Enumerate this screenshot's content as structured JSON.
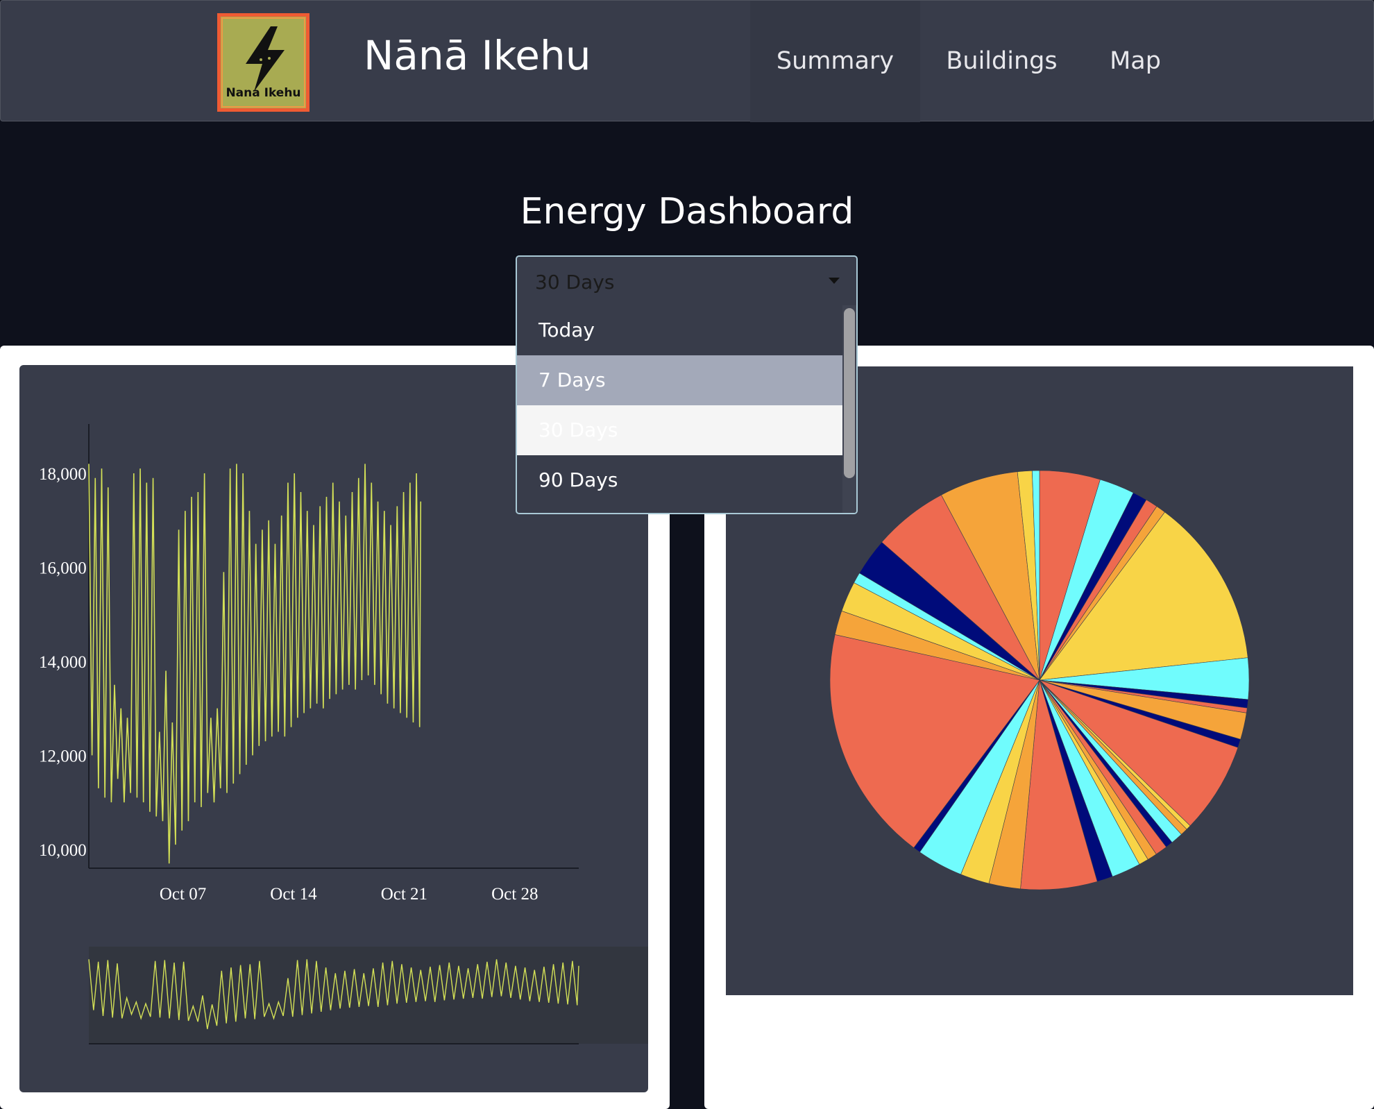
{
  "navbar": {
    "logo_text": "Nana Ikehu",
    "brand": "Nānā Ikehu",
    "items": [
      {
        "label": "Summary"
      },
      {
        "label": "Buildings"
      },
      {
        "label": "Map"
      }
    ]
  },
  "page": {
    "title": "Energy Dashboard"
  },
  "range_select": {
    "selected": "30 Days",
    "options": [
      "Today",
      "7 Days",
      "30 Days",
      "90 Days"
    ],
    "highlighted": "7 Days"
  },
  "colors": {
    "line": "#d4e157",
    "pie": [
      "#ee6a50",
      "#f5a43a",
      "#f8d447",
      "#70fcfd",
      "#000b7a"
    ]
  },
  "chart_data": [
    {
      "type": "line",
      "title": "",
      "xlabel": "",
      "ylabel": "",
      "x_ticks": [
        "Oct 07",
        "Oct 14",
        "Oct 21",
        "Oct 28"
      ],
      "y_ticks": [
        "10,000",
        "12,000",
        "14,000",
        "16,000",
        "18,000"
      ],
      "ylim": [
        9600,
        18900
      ],
      "x_range_days": [
        2,
        33
      ],
      "series": [
        {
          "x": [
            2.0,
            2.3,
            2.6,
            2.9,
            3.2,
            3.5,
            3.8,
            4.1,
            4.4,
            4.7,
            5.0,
            5.3,
            5.6,
            5.9,
            6.2,
            6.5,
            6.8,
            7.1,
            7.4,
            7.7,
            8.0,
            8.3,
            8.6,
            8.9,
            9.2,
            9.5,
            9.8,
            10.1,
            10.4,
            10.7,
            11.0,
            11.3,
            11.6,
            11.9,
            12.2,
            12.5,
            12.8,
            13.1,
            13.4,
            13.7,
            14.0,
            14.3,
            14.6,
            14.9,
            15.2,
            15.5,
            15.8,
            16.1,
            16.4,
            16.7,
            17.0,
            17.3,
            17.6,
            17.9,
            18.2,
            18.5,
            18.8,
            19.1,
            19.4,
            19.7,
            20.0,
            20.3,
            20.6,
            20.9,
            21.2,
            21.5,
            21.8,
            22.1,
            22.4,
            22.7,
            23.0,
            23.3,
            23.6,
            23.9,
            24.2,
            24.5,
            24.8,
            25.1,
            25.4,
            25.7,
            26.0,
            26.3,
            26.6,
            26.9,
            27.2,
            27.5,
            27.8,
            28.1,
            28.4,
            28.7,
            29.0,
            29.3,
            29.6,
            29.9,
            30.2,
            30.5,
            30.8,
            31.1,
            31.4,
            31.7,
            32.0,
            32.3,
            32.6,
            32.9,
            33.0
          ],
          "y": [
            18200,
            12000,
            17900,
            11300,
            18100,
            11100,
            17700,
            11000,
            13500,
            11500,
            13000,
            11000,
            12800,
            11200,
            18000,
            11100,
            18100,
            11000,
            17800,
            10800,
            17900,
            10700,
            12500,
            10600,
            13800,
            9700,
            12700,
            10100,
            16800,
            10400,
            17200,
            10600,
            17500,
            11000,
            17600,
            10900,
            18000,
            11200,
            12800,
            11000,
            13000,
            11300,
            15900,
            11200,
            18100,
            11400,
            18200,
            11600,
            18000,
            11800,
            17200,
            12000,
            16500,
            12200,
            16800,
            12300,
            17000,
            12400,
            16500,
            12500,
            17100,
            12400,
            17800,
            12600,
            18000,
            12800,
            17600,
            12900,
            17200,
            13000,
            16900,
            13100,
            17300,
            13000,
            17500,
            13200,
            17800,
            13300,
            17400,
            13400,
            17100,
            13500,
            17600,
            13400,
            17900,
            13600,
            18200,
            13700,
            17800,
            13500,
            17400,
            13300,
            17200,
            13100,
            16900,
            13000,
            17300,
            12900,
            17600,
            12800,
            17800,
            12700,
            18000,
            12600,
            17400
          ]
        }
      ]
    },
    {
      "type": "pie",
      "title": "",
      "slices": [
        {
          "value": 5.0,
          "color": "#ee6a50"
        },
        {
          "value": 2.9,
          "color": "#70fcfd"
        },
        {
          "value": 1.2,
          "color": "#000b7a"
        },
        {
          "value": 1.0,
          "color": "#ee6a50"
        },
        {
          "value": 0.8,
          "color": "#f5a43a"
        },
        {
          "value": 14.0,
          "color": "#f8d447"
        },
        {
          "value": 3.4,
          "color": "#70fcfd"
        },
        {
          "value": 0.7,
          "color": "#000b7a"
        },
        {
          "value": 0.4,
          "color": "#ee6a50"
        },
        {
          "value": 2.2,
          "color": "#f5a43a"
        },
        {
          "value": 0.7,
          "color": "#000b7a"
        },
        {
          "value": 7.5,
          "color": "#ee6a50"
        },
        {
          "value": 0.4,
          "color": "#f8d447"
        },
        {
          "value": 0.6,
          "color": "#f5a43a"
        },
        {
          "value": 1.0,
          "color": "#70fcfd"
        },
        {
          "value": 0.6,
          "color": "#000b7a"
        },
        {
          "value": 1.0,
          "color": "#ee6a50"
        },
        {
          "value": 0.8,
          "color": "#f5a43a"
        },
        {
          "value": 0.8,
          "color": "#f8d447"
        },
        {
          "value": 2.4,
          "color": "#70fcfd"
        },
        {
          "value": 1.3,
          "color": "#000b7a"
        },
        {
          "value": 6.3,
          "color": "#ee6a50"
        },
        {
          "value": 2.6,
          "color": "#f5a43a"
        },
        {
          "value": 2.4,
          "color": "#f8d447"
        },
        {
          "value": 3.8,
          "color": "#70fcfd"
        },
        {
          "value": 0.6,
          "color": "#000b7a"
        },
        {
          "value": 19.5,
          "color": "#ee6a50"
        },
        {
          "value": 2.0,
          "color": "#f5a43a"
        },
        {
          "value": 2.5,
          "color": "#f8d447"
        },
        {
          "value": 0.9,
          "color": "#70fcfd"
        },
        {
          "value": 3.1,
          "color": "#000b7a"
        },
        {
          "value": 6.2,
          "color": "#ee6a50"
        },
        {
          "value": 6.5,
          "color": "#f5a43a"
        },
        {
          "value": 1.2,
          "color": "#f8d447"
        },
        {
          "value": 0.6,
          "color": "#70fcfd"
        }
      ]
    }
  ]
}
